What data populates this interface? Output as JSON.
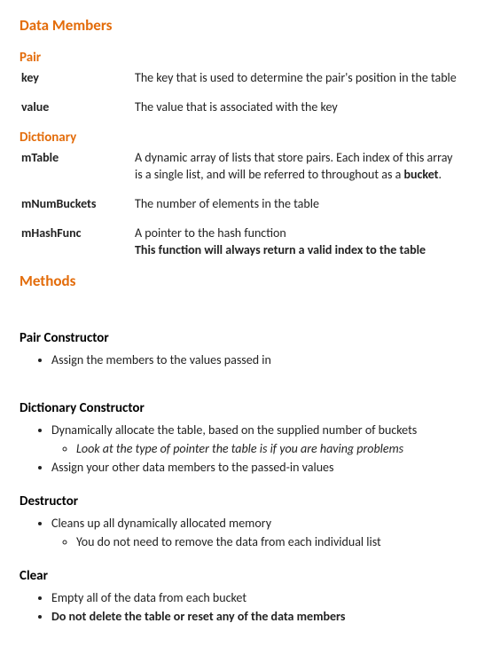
{
  "sections": {
    "dataMembers": {
      "title": "Data Members",
      "pair": {
        "title": "Pair",
        "members": {
          "key": {
            "name": "key",
            "desc": "The key that is used to determine the pair's position in the table"
          },
          "value": {
            "name": "value",
            "desc": "The value that is associated with the key"
          }
        }
      },
      "dictionary": {
        "title": "Dictionary",
        "members": {
          "mTable": {
            "name": "mTable",
            "desc_pre": "A dynamic array of lists that store pairs. Each index of this array is a single list, and will be referred to throughout as a ",
            "desc_bold": "bucket",
            "desc_post": "."
          },
          "mNumBuckets": {
            "name": "mNumBuckets",
            "desc": "The number of elements in the table"
          },
          "mHashFunc": {
            "name": "mHashFunc",
            "desc_line1": "A pointer to the hash function",
            "desc_line2_bold": "This function will always return a valid index to the table"
          }
        }
      }
    },
    "methods": {
      "title": "Methods",
      "pairCtor": {
        "title": "Pair Constructor",
        "b1": "Assign the members to the values passed in"
      },
      "dictCtor": {
        "title": "Dictionary Constructor",
        "b1": "Dynamically allocate the table, based on the supplied number of buckets",
        "b1_sub_italic": "Look at the type of pointer the table is if you are having problems",
        "b2": "Assign your other data members to the passed-in values"
      },
      "destructor": {
        "title": "Destructor",
        "b1": "Cleans up all dynamically allocated memory",
        "b1_sub": "You do not need to remove the data from each individual list"
      },
      "clear": {
        "title": "Clear",
        "b1": "Empty all of the data from each bucket",
        "b2_bold": "Do not delete the table or reset any of the data members"
      }
    }
  }
}
